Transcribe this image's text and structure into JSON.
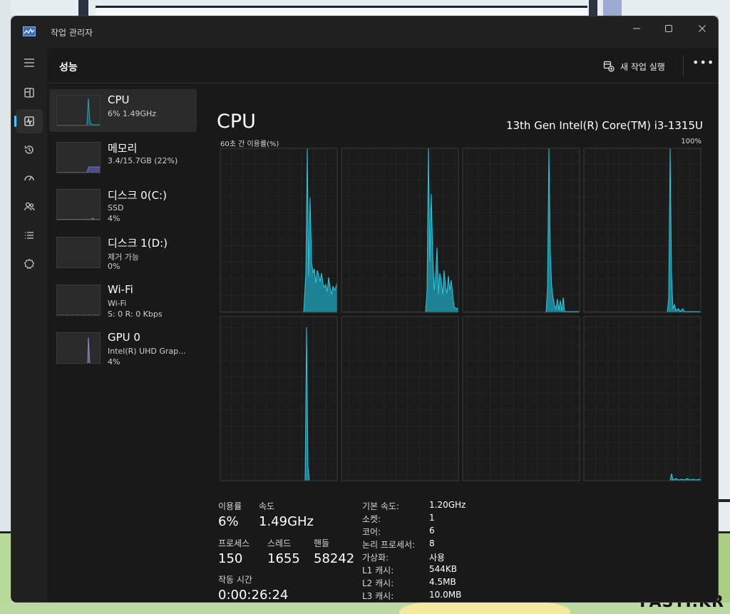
{
  "window": {
    "title": "작업 관리자"
  },
  "watermark": "FASTI.KR",
  "header": {
    "title": "성능",
    "new_task_label": "새 작업 실행"
  },
  "nav": [
    "menu-icon",
    "processes-icon",
    "performance-icon",
    "app-history-icon",
    "startup-apps-icon",
    "users-icon",
    "details-icon",
    "services-icon",
    "settings-icon"
  ],
  "resources": [
    {
      "name": "CPU",
      "line1": "6% 1.49GHz"
    },
    {
      "name": "메모리",
      "line1": "3.4/15.7GB (22%)"
    },
    {
      "name": "디스크 0(C:)",
      "line1": "SSD",
      "line2": "4%"
    },
    {
      "name": "디스크 1(D:)",
      "line1": "제거 가능",
      "line2": "0%"
    },
    {
      "name": "Wi-Fi",
      "line1": "Wi-Fi",
      "line2": "S: 0 R: 0 Kbps"
    },
    {
      "name": "GPU 0",
      "line1": "Intel(R) UHD Grap...",
      "line2": "4%"
    }
  ],
  "detail": {
    "title": "CPU",
    "model": "13th Gen Intel(R) Core(TM) i3-1315U",
    "graph_label": "60초 간 이용률(%)",
    "graph_max": "100%"
  },
  "stats": {
    "usage_label": "이용률",
    "usage_value": "6%",
    "speed_label": "속도",
    "speed_value": "1.49GHz",
    "processes_label": "프로세스",
    "processes_value": "150",
    "threads_label": "스레드",
    "threads_value": "1655",
    "handles_label": "핸들",
    "handles_value": "58242",
    "uptime_label": "작동 시간",
    "uptime_value": "0:00:26:24"
  },
  "specs": [
    {
      "label": "기본 속도:",
      "value": "1.20GHz"
    },
    {
      "label": "소켓:",
      "value": "1"
    },
    {
      "label": "코어:",
      "value": "6"
    },
    {
      "label": "논리 프로세서:",
      "value": "8"
    },
    {
      "label": "가상화:",
      "value": "사용"
    },
    {
      "label": "L1 캐시:",
      "value": "544KB"
    },
    {
      "label": "L2 캐시:",
      "value": "4.5MB"
    },
    {
      "label": "L3 캐시:",
      "value": "10.0MB"
    }
  ],
  "colors": {
    "cpu_line": "#1fa7bd",
    "cpu_fill": "#1fa7bd",
    "memory": "#6a6ed8",
    "gpu": "#9b7fd6",
    "accent": "#4cc2ff"
  }
}
